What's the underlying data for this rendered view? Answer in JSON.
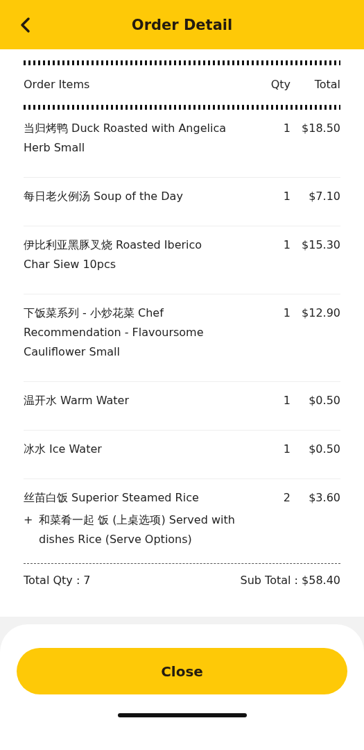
{
  "header": {
    "title": "Order Detail"
  },
  "columns": {
    "item": "Order Items",
    "qty": "Qty",
    "total": "Total"
  },
  "items": [
    {
      "name": "当归烤鸭 Duck Roasted with Angelica Herb Small",
      "qty": "1",
      "total": "$18.50"
    },
    {
      "name": "每日老火例汤 Soup of the Day",
      "qty": "1",
      "total": "$7.10"
    },
    {
      "name": "伊比利亚黑豚叉烧 Roasted Iberico Char Siew 10pcs",
      "qty": "1",
      "total": "$15.30"
    },
    {
      "name": "下饭菜系列 - 小炒花菜 Chef Recommendation - Flavoursome Cauliflower Small",
      "qty": "1",
      "total": "$12.90"
    },
    {
      "name": "温开水 Warm Water",
      "qty": "1",
      "total": "$0.50"
    },
    {
      "name": "冰水 Ice Water",
      "qty": "1",
      "total": "$0.50"
    },
    {
      "name": "丝苗白饭 Superior Steamed Rice",
      "qty": "2",
      "total": "$3.60",
      "addons": [
        {
          "prefix": "+",
          "text": "和菜肴一起 饭 (上桌选项) Served with dishes Rice (Serve Options)"
        }
      ]
    }
  ],
  "summary": {
    "total_qty": "Total Qty : 7",
    "sub_total": "Sub Total : $58.40"
  },
  "close_button": "Close"
}
